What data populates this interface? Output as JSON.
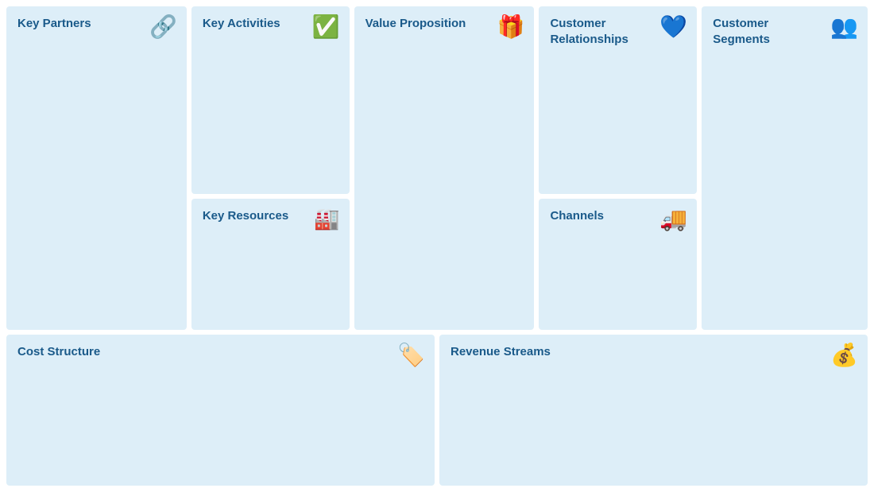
{
  "cells": {
    "key_partners": {
      "title": "Key Partners",
      "icon": "🔗"
    },
    "key_activities": {
      "title": "Key Activities",
      "icon": "✅"
    },
    "key_resources": {
      "title": "Key Resources",
      "icon": "🏭"
    },
    "value_proposition": {
      "title": "Value Proposition",
      "icon": "🎁"
    },
    "customer_relationships": {
      "title": "Customer Relationships",
      "icon": "💙"
    },
    "channels": {
      "title": "Channels",
      "icon": "🚚"
    },
    "customer_segments": {
      "title": "Customer Segments",
      "icon": "👥"
    },
    "cost_structure": {
      "title": "Cost Structure",
      "icon": "🏷️"
    },
    "revenue_streams": {
      "title": "Revenue Streams",
      "icon": "💰"
    }
  }
}
